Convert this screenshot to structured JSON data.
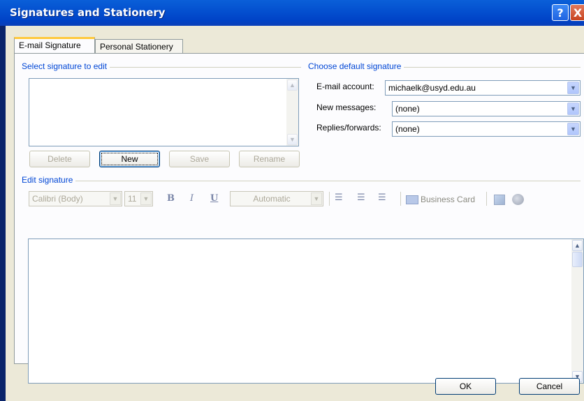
{
  "window": {
    "title": "Signatures and Stationery",
    "help_glyph": "?",
    "close_glyph": "X"
  },
  "tabs": [
    {
      "label": "E-mail Signature"
    },
    {
      "label": "Personal Stationery"
    }
  ],
  "select_signature": {
    "group_label": "Select signature to edit",
    "buttons": {
      "delete": "Delete",
      "new": "New",
      "save": "Save",
      "rename": "Rename"
    }
  },
  "default_signature": {
    "group_label": "Choose default signature",
    "email_account_label": "E-mail account:",
    "email_account_value": "michaelk@usyd.edu.au",
    "new_messages_label": "New messages:",
    "new_messages_value": "(none)",
    "replies_label": "Replies/forwards:",
    "replies_value": "(none)"
  },
  "edit_signature": {
    "group_label": "Edit signature",
    "toolbar": {
      "font": "Calibri (Body)",
      "size": "11",
      "bold": "B",
      "italic": "I",
      "underline": "U",
      "color": "Automatic",
      "business_card": "Business Card",
      "icons": [
        "align-left-icon",
        "align-center-icon",
        "align-right-icon",
        "business-card-icon",
        "insert-picture-icon",
        "insert-hyperlink-icon"
      ]
    }
  },
  "footer": {
    "ok": "OK",
    "cancel": "Cancel"
  },
  "colors": {
    "titlebar": "#0451d0",
    "dialog_bg": "#ece9d8",
    "group_label": "#0046d5"
  }
}
